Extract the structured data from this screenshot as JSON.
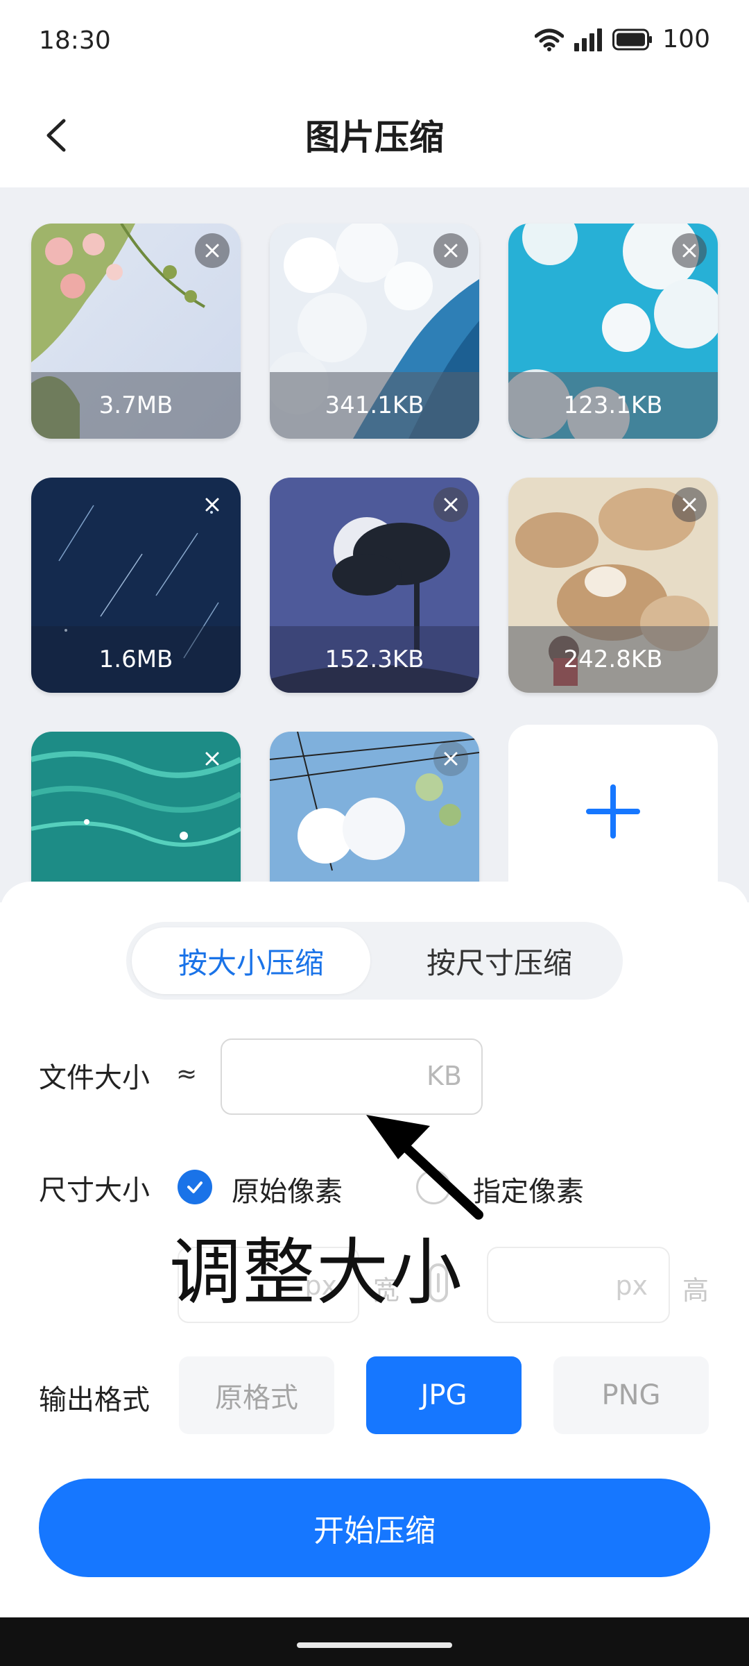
{
  "status": {
    "time": "18:30",
    "battery": "100"
  },
  "header": {
    "title": "图片压缩"
  },
  "images": [
    {
      "size": "3.7MB"
    },
    {
      "size": "341.1KB"
    },
    {
      "size": "123.1KB"
    },
    {
      "size": "1.6MB"
    },
    {
      "size": "152.3KB"
    },
    {
      "size": "242.8KB"
    },
    {
      "size": ""
    },
    {
      "size": ""
    }
  ],
  "tabs": {
    "by_size": "按大小压缩",
    "by_dimension": "按尺寸压缩"
  },
  "file_size": {
    "label": "文件大小",
    "approx": "≈",
    "unit": "KB",
    "value": ""
  },
  "dimension": {
    "label": "尺寸大小",
    "option_original": "原始像素",
    "option_custom": "指定像素",
    "width_unit": "px",
    "width_label": "宽",
    "height_unit": "px",
    "height_label": "高"
  },
  "annotation": {
    "text": "调整大小"
  },
  "output_format": {
    "label": "输出格式",
    "options": [
      "原格式",
      "JPG",
      "PNG"
    ],
    "selected": "JPG"
  },
  "start_button": "开始压缩",
  "colors": {
    "accent": "#1677ff",
    "panel_bg": "#eef0f4"
  }
}
